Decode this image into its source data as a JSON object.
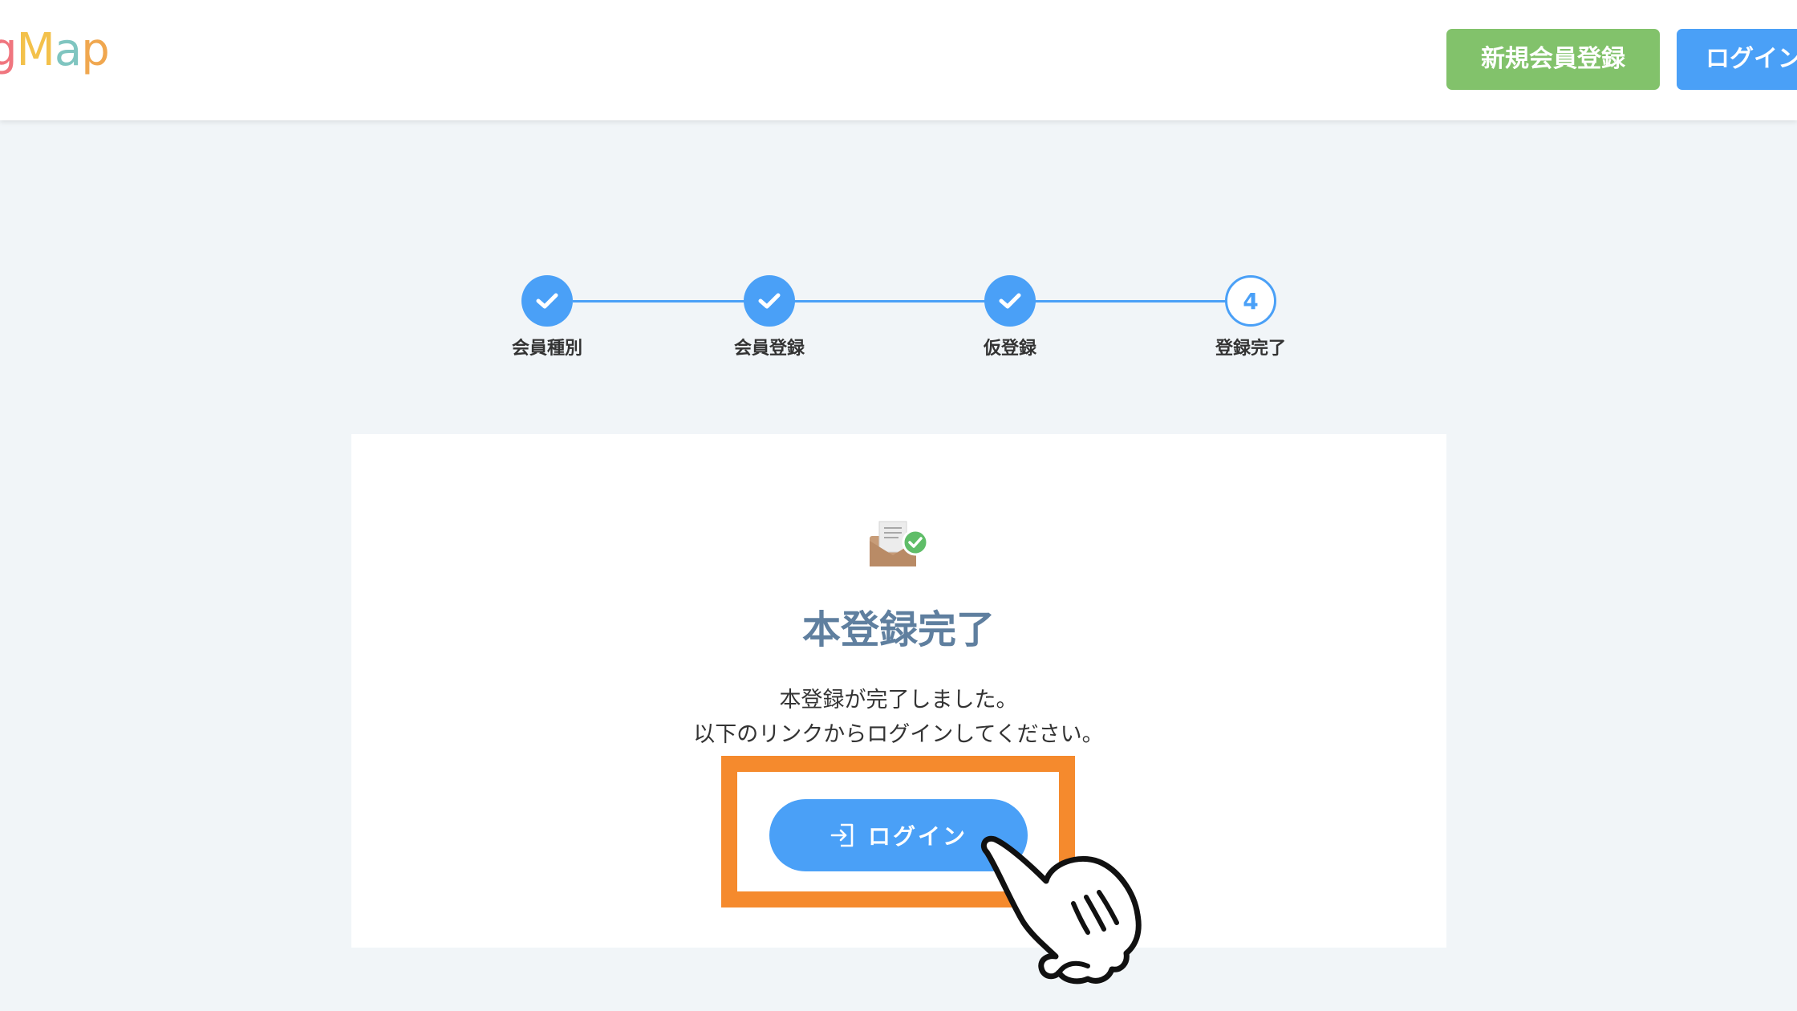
{
  "header": {
    "logo_letters": [
      "g",
      "M",
      "a",
      "p"
    ],
    "logo_colors": [
      "#f0767f",
      "#f3c14b",
      "#7fc5c0",
      "#f0a74f"
    ],
    "register_label": "新規会員登録",
    "login_label": "ログイン"
  },
  "steps": [
    {
      "label": "会員種別",
      "status": "done",
      "icon": "check-icon"
    },
    {
      "label": "会員登録",
      "status": "done",
      "icon": "check-icon"
    },
    {
      "label": "仮登録",
      "status": "done",
      "icon": "check-icon"
    },
    {
      "label": "登録完了",
      "status": "current",
      "number": "4"
    }
  ],
  "card": {
    "icon": "mail-check-icon",
    "title": "本登録完了",
    "message_line1": "本登録が完了しました。",
    "message_line2": "以下のリンクからログインしてください。",
    "login_button_label": "ログイン",
    "login_button_icon": "login-icon"
  },
  "colors": {
    "accent": "#4aa0f7",
    "register_green": "#82c26b",
    "highlight_orange": "#f58a2d",
    "title_slate": "#5f7f9f"
  }
}
